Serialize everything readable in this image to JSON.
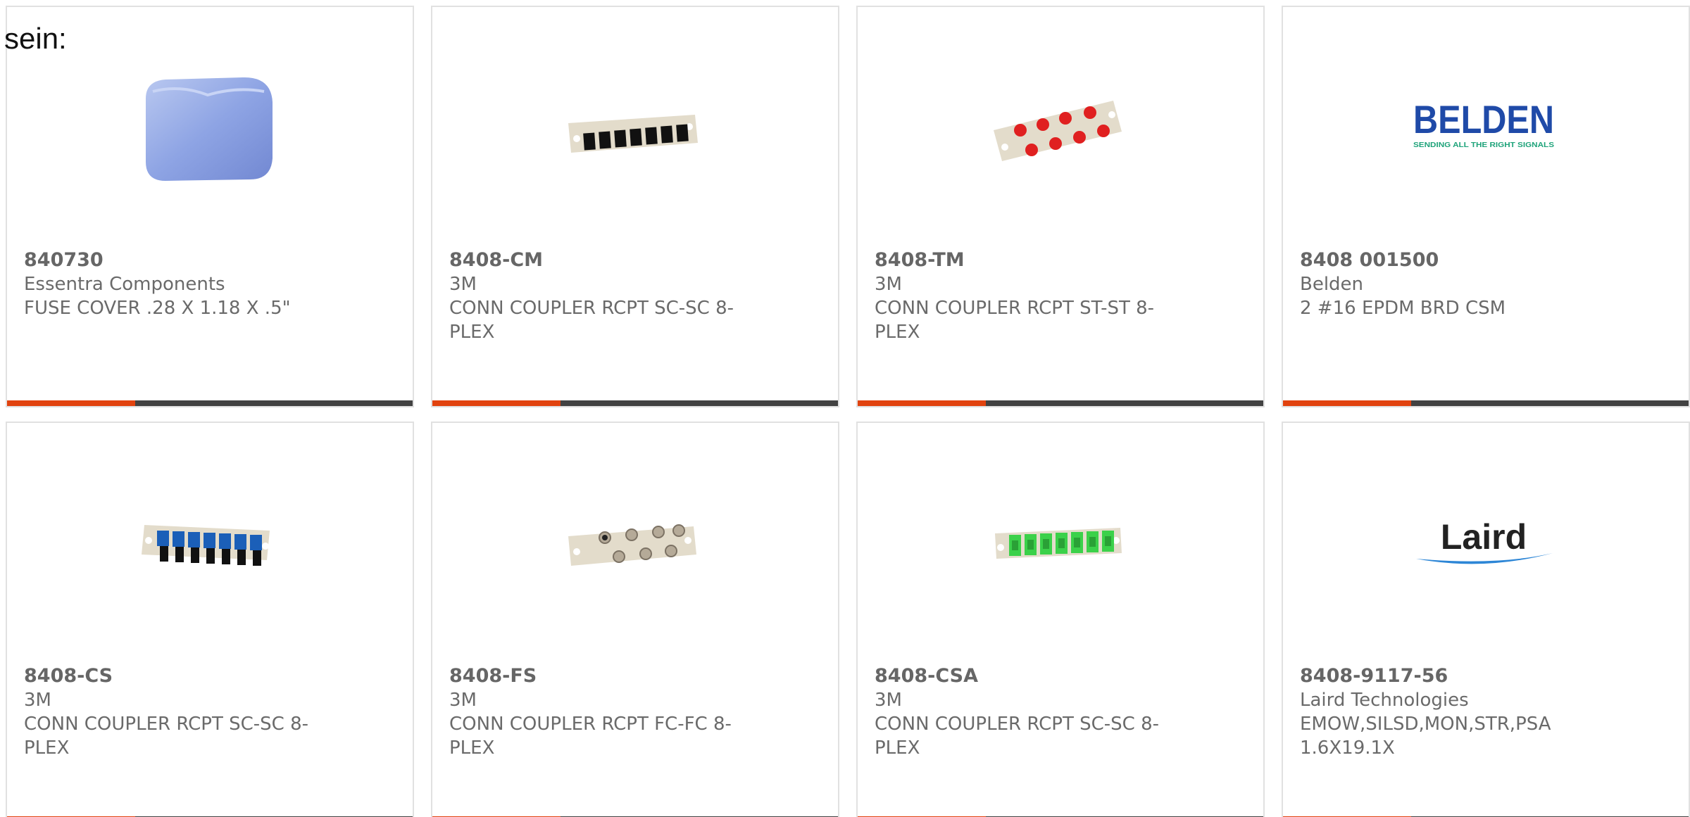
{
  "page": {
    "cut_text": "sein:"
  },
  "products": [
    {
      "part_number": "840730",
      "manufacturer": "Essentra Components",
      "description": "FUSE COVER .28 X 1.18 X .5\"",
      "image": "blue-fuse-cover"
    },
    {
      "part_number": "8408-CM",
      "manufacturer": "3M",
      "description": "CONN COUPLER RCPT SC-SC 8-PLEX",
      "image": "coupler-black-sc"
    },
    {
      "part_number": "8408-TM",
      "manufacturer": "3M",
      "description": "CONN COUPLER RCPT ST-ST 8-PLEX",
      "image": "coupler-red-st"
    },
    {
      "part_number": "8408 001500",
      "manufacturer": "Belden",
      "description": "2 #16 EPDM BRD CSM",
      "image": "belden-logo"
    },
    {
      "part_number": "8408-CS",
      "manufacturer": "3M",
      "description": "CONN COUPLER RCPT SC-SC 8-PLEX",
      "image": "coupler-blue-sc"
    },
    {
      "part_number": "8408-FS",
      "manufacturer": "3M",
      "description": "CONN COUPLER RCPT FC-FC 8-PLEX",
      "image": "coupler-fc"
    },
    {
      "part_number": "8408-CSA",
      "manufacturer": "3M",
      "description": "CONN COUPLER RCPT SC-SC 8-PLEX",
      "image": "coupler-green-sc"
    },
    {
      "part_number": "8408-9117-56",
      "manufacturer": "Laird Technologies",
      "description": "EMOW,SILSD,MON,STR,PSA 1.6X19.1X",
      "image": "laird-logo"
    }
  ],
  "logos": {
    "belden_name": "BELDEN",
    "belden_tagline": "SENDING ALL THE RIGHT SIGNALS",
    "laird_name": "Laird"
  },
  "colors": {
    "accent": "#e1430f",
    "bar": "#424242",
    "text": "#6a6a6a",
    "border": "#e1e1e1"
  }
}
